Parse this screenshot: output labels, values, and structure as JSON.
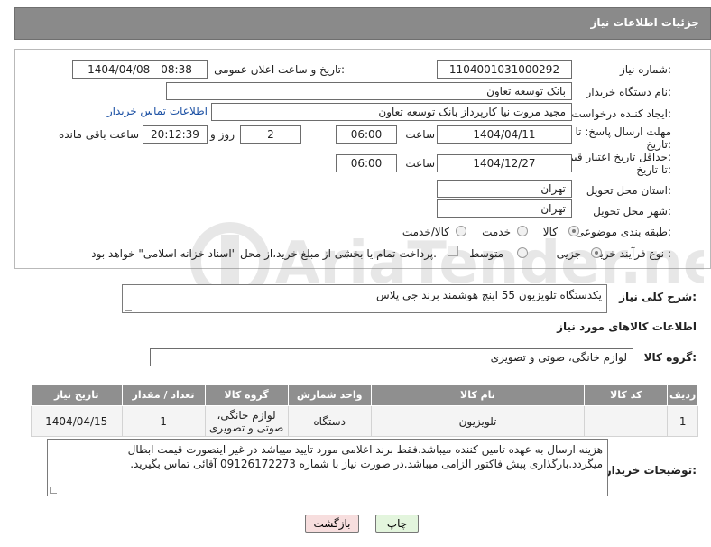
{
  "header": {
    "title": "جزئیات اطلاعات نیاز"
  },
  "form": {
    "need_number": {
      "label": "شماره نیاز:",
      "value": "1104001031000292"
    },
    "announce_datetime": {
      "label": "تاریخ و ساعت اعلان عمومی:",
      "value": "1404/04/08 - 08:38"
    },
    "buyer_org": {
      "label": "نام دستگاه خریدار:",
      "value": "بانک توسعه تعاون"
    },
    "requester": {
      "label": "ایجاد کننده درخواست:",
      "value": "مجید مروت نیا کارپرداز بانک توسعه تعاون",
      "contact_link": "اطلاعات تماس خریدار"
    },
    "response_deadline": {
      "label_line1": "مهلت ارسال پاسخ: تا",
      "label_line2": "تاریخ:",
      "date": "1404/04/11",
      "time_label": "ساعت",
      "time": "06:00",
      "days": "2",
      "days_label": "روز و",
      "remaining": "20:12:39",
      "remaining_label": "ساعت باقی مانده"
    },
    "price_validity": {
      "label_line1": "حداقل تاریخ اعتبار قیمت:",
      "label_line2": "تا تاریخ:",
      "date": "1404/12/27",
      "time_label": "ساعت",
      "time": "06:00"
    },
    "delivery_province": {
      "label": "استان محل تحویل:",
      "value": "تهران"
    },
    "delivery_city": {
      "label": "شهر محل تحویل:",
      "value": "تهران"
    },
    "category": {
      "label": "طبقه بندی موضوعی:",
      "options": [
        "کالا",
        "خدمت",
        "کالا/خدمت"
      ],
      "selected": "کالا"
    },
    "purchase_process": {
      "label": "نوع فرآیند خرید :",
      "options": [
        "جزیی",
        "متوسط"
      ],
      "selected": "جزیی",
      "payment_note": "پرداخت تمام یا بخشی از مبلغ خرید،از محل \"اسناد خزانه اسلامی\" خواهد بود."
    }
  },
  "summary": {
    "label": "شرح کلی نیاز:",
    "value": "یکدستگاه تلویزیون 55 اینچ هوشمند برند جی پلاس"
  },
  "goods_section": {
    "title": "اطلاعات کالاهای مورد نیاز",
    "group_label": "گروه کالا:",
    "group_value": "لوازم خانگی، صوتی و تصویری"
  },
  "items_table": {
    "headers": [
      "ردیف",
      "کد کالا",
      "نام کالا",
      "واحد شمارش",
      "گروه کالا",
      "تعداد / مقدار",
      "تاریخ نیاز"
    ],
    "rows": [
      [
        "1",
        "--",
        "تلویزیون",
        "دستگاه",
        "لوازم خانگی، صوتی و تصویری",
        "1",
        "1404/04/15"
      ]
    ]
  },
  "buyer_notes": {
    "label": "توضیحات خریدار:",
    "value": "هزینه ارسال به عهده تامین کننده میباشد.فقط برند اعلامی مورد تایید میباشد در غیر اینصورت قیمت ابطال میگردد.بارگذاری پیش فاکتور الزامی میباشد.در صورت نیاز با شماره 09126172273 آقائی تماس بگیرید."
  },
  "buttons": {
    "print": "چاپ",
    "back": "بازگشت"
  },
  "watermark": {
    "text": "AriaTender.neT"
  },
  "colors": {
    "header_bg": "#8a8a8a",
    "link": "#1a4fa3",
    "back_button": "#f7dede",
    "print_button": "#e3f5dd"
  }
}
